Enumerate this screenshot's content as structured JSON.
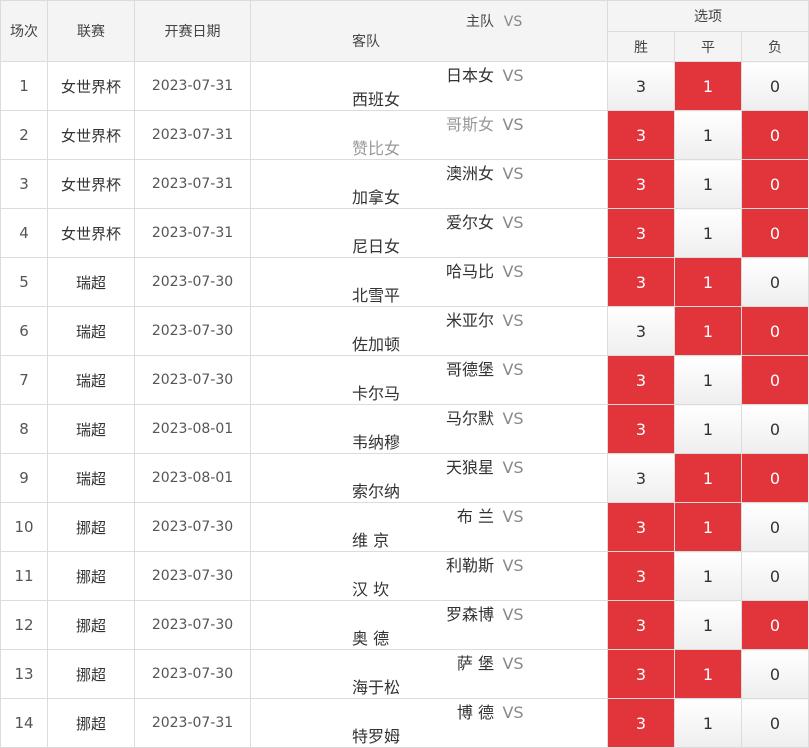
{
  "headers": {
    "round": "场次",
    "league": "联赛",
    "date": "开赛日期",
    "home": "主队",
    "vs": "VS",
    "away": "客队",
    "options": "选项",
    "win": "胜",
    "draw": "平",
    "lose": "负"
  },
  "colors": {
    "selected": "#e1353b",
    "header_bg": "#f4f4f4"
  },
  "rows": [
    {
      "num": "1",
      "league": "女世界杯",
      "date": "2023-07-31",
      "home": "日本女",
      "vs": "VS",
      "away": "西班女",
      "win": "3",
      "draw": "1",
      "lose": "0",
      "sel": [
        false,
        true,
        false
      ],
      "dim": false
    },
    {
      "num": "2",
      "league": "女世界杯",
      "date": "2023-07-31",
      "home": "哥斯女",
      "vs": "VS",
      "away": "赞比女",
      "win": "3",
      "draw": "1",
      "lose": "0",
      "sel": [
        true,
        false,
        true
      ],
      "dim": true
    },
    {
      "num": "3",
      "league": "女世界杯",
      "date": "2023-07-31",
      "home": "澳洲女",
      "vs": "VS",
      "away": "加拿女",
      "win": "3",
      "draw": "1",
      "lose": "0",
      "sel": [
        true,
        false,
        true
      ],
      "dim": false
    },
    {
      "num": "4",
      "league": "女世界杯",
      "date": "2023-07-31",
      "home": "爱尔女",
      "vs": "VS",
      "away": "尼日女",
      "win": "3",
      "draw": "1",
      "lose": "0",
      "sel": [
        true,
        false,
        true
      ],
      "dim": false
    },
    {
      "num": "5",
      "league": "瑞超",
      "date": "2023-07-30",
      "home": "哈马比",
      "vs": "VS",
      "away": "北雪平",
      "win": "3",
      "draw": "1",
      "lose": "0",
      "sel": [
        true,
        true,
        false
      ],
      "dim": false
    },
    {
      "num": "6",
      "league": "瑞超",
      "date": "2023-07-30",
      "home": "米亚尔",
      "vs": "VS",
      "away": "佐加顿",
      "win": "3",
      "draw": "1",
      "lose": "0",
      "sel": [
        false,
        true,
        true
      ],
      "dim": false
    },
    {
      "num": "7",
      "league": "瑞超",
      "date": "2023-07-30",
      "home": "哥德堡",
      "vs": "VS",
      "away": "卡尔马",
      "win": "3",
      "draw": "1",
      "lose": "0",
      "sel": [
        true,
        false,
        true
      ],
      "dim": false
    },
    {
      "num": "8",
      "league": "瑞超",
      "date": "2023-08-01",
      "home": "马尔默",
      "vs": "VS",
      "away": "韦纳穆",
      "win": "3",
      "draw": "1",
      "lose": "0",
      "sel": [
        true,
        false,
        false
      ],
      "dim": false
    },
    {
      "num": "9",
      "league": "瑞超",
      "date": "2023-08-01",
      "home": "天狼星",
      "vs": "VS",
      "away": "索尔纳",
      "win": "3",
      "draw": "1",
      "lose": "0",
      "sel": [
        false,
        true,
        true
      ],
      "dim": false
    },
    {
      "num": "10",
      "league": "挪超",
      "date": "2023-07-30",
      "home": "布 兰",
      "vs": "VS",
      "away": "维 京",
      "win": "3",
      "draw": "1",
      "lose": "0",
      "sel": [
        true,
        true,
        false
      ],
      "dim": false
    },
    {
      "num": "11",
      "league": "挪超",
      "date": "2023-07-30",
      "home": "利勒斯",
      "vs": "VS",
      "away": "汉 坎",
      "win": "3",
      "draw": "1",
      "lose": "0",
      "sel": [
        true,
        false,
        false
      ],
      "dim": false
    },
    {
      "num": "12",
      "league": "挪超",
      "date": "2023-07-30",
      "home": "罗森博",
      "vs": "VS",
      "away": "奥 德",
      "win": "3",
      "draw": "1",
      "lose": "0",
      "sel": [
        true,
        false,
        true
      ],
      "dim": false
    },
    {
      "num": "13",
      "league": "挪超",
      "date": "2023-07-30",
      "home": "萨 堡",
      "vs": "VS",
      "away": "海于松",
      "win": "3",
      "draw": "1",
      "lose": "0",
      "sel": [
        true,
        true,
        false
      ],
      "dim": false
    },
    {
      "num": "14",
      "league": "挪超",
      "date": "2023-07-31",
      "home": "博 德",
      "vs": "VS",
      "away": "特罗姆",
      "win": "3",
      "draw": "1",
      "lose": "0",
      "sel": [
        true,
        false,
        false
      ],
      "dim": false
    }
  ]
}
